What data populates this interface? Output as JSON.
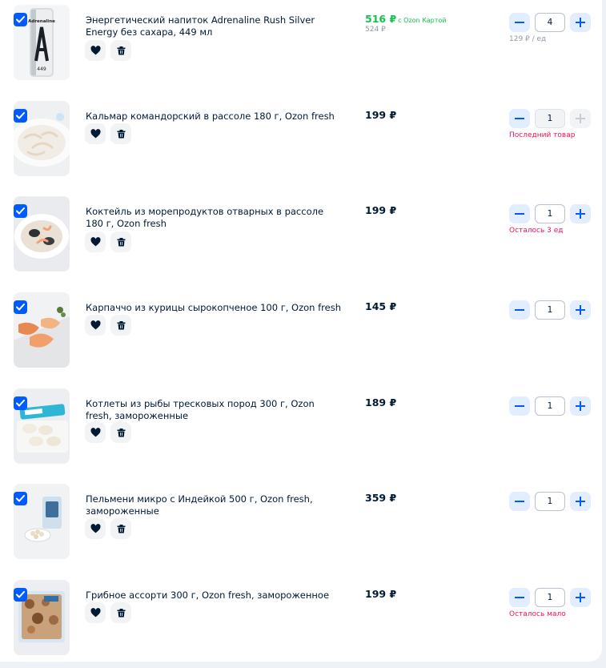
{
  "cart": {
    "items": [
      {
        "title": "Энергетический напиток Adrenaline Rush Silver Energy без сахара, 449 мл",
        "price": "516 ₽",
        "price_tag": "с Ozon Картой",
        "old_price": "524 ₽",
        "quantity": "4",
        "note": "129 ₽ / ед",
        "plus_enabled": true,
        "image_icon": "energy-drink-can-image",
        "can_text": "Adrenaline",
        "can_volume": "449"
      },
      {
        "title": "Кальмар командорский в рассоле 180 г, Ozon fresh",
        "price": "199 ₽",
        "quantity": "1",
        "note": "Последний товар",
        "plus_enabled": false,
        "image_icon": "squid-plate-image"
      },
      {
        "title": "Коктейль из морепродуктов отварных в рассоле 180 г, Ozon fresh",
        "price": "199 ₽",
        "quantity": "1",
        "note": "Осталось 3 ед",
        "plus_enabled": true,
        "image_icon": "seafood-plate-image"
      },
      {
        "title": "Карпаччо из курицы сырокопченое 100 г, Ozon fresh",
        "price": "145 ₽",
        "quantity": "1",
        "note": "",
        "plus_enabled": true,
        "image_icon": "chicken-carpaccio-image"
      },
      {
        "title": "Котлеты из рыбы тресковых пород 300 г, Ozon fresh, замороженные",
        "price": "189 ₽",
        "quantity": "1",
        "note": "",
        "plus_enabled": true,
        "image_icon": "fish-cutlets-image"
      },
      {
        "title": "Пельмени микро с Индейкой 500 г, Ozon fresh, замороженные",
        "price": "359 ₽",
        "quantity": "1",
        "note": "",
        "plus_enabled": true,
        "image_icon": "dumplings-pack-image"
      },
      {
        "title": "Грибное ассорти 300 г, Ozon fresh, замороженное",
        "price": "199 ₽",
        "quantity": "1",
        "note": "Осталось мало",
        "plus_enabled": true,
        "image_icon": "mushroom-mix-image"
      }
    ]
  },
  "colors": {
    "accent": "#005bff",
    "accent_soft": "#e2edff",
    "price_green": "#10c44c",
    "warning": "#f91155",
    "muted": "#8f99a8",
    "text": "#001a34"
  }
}
